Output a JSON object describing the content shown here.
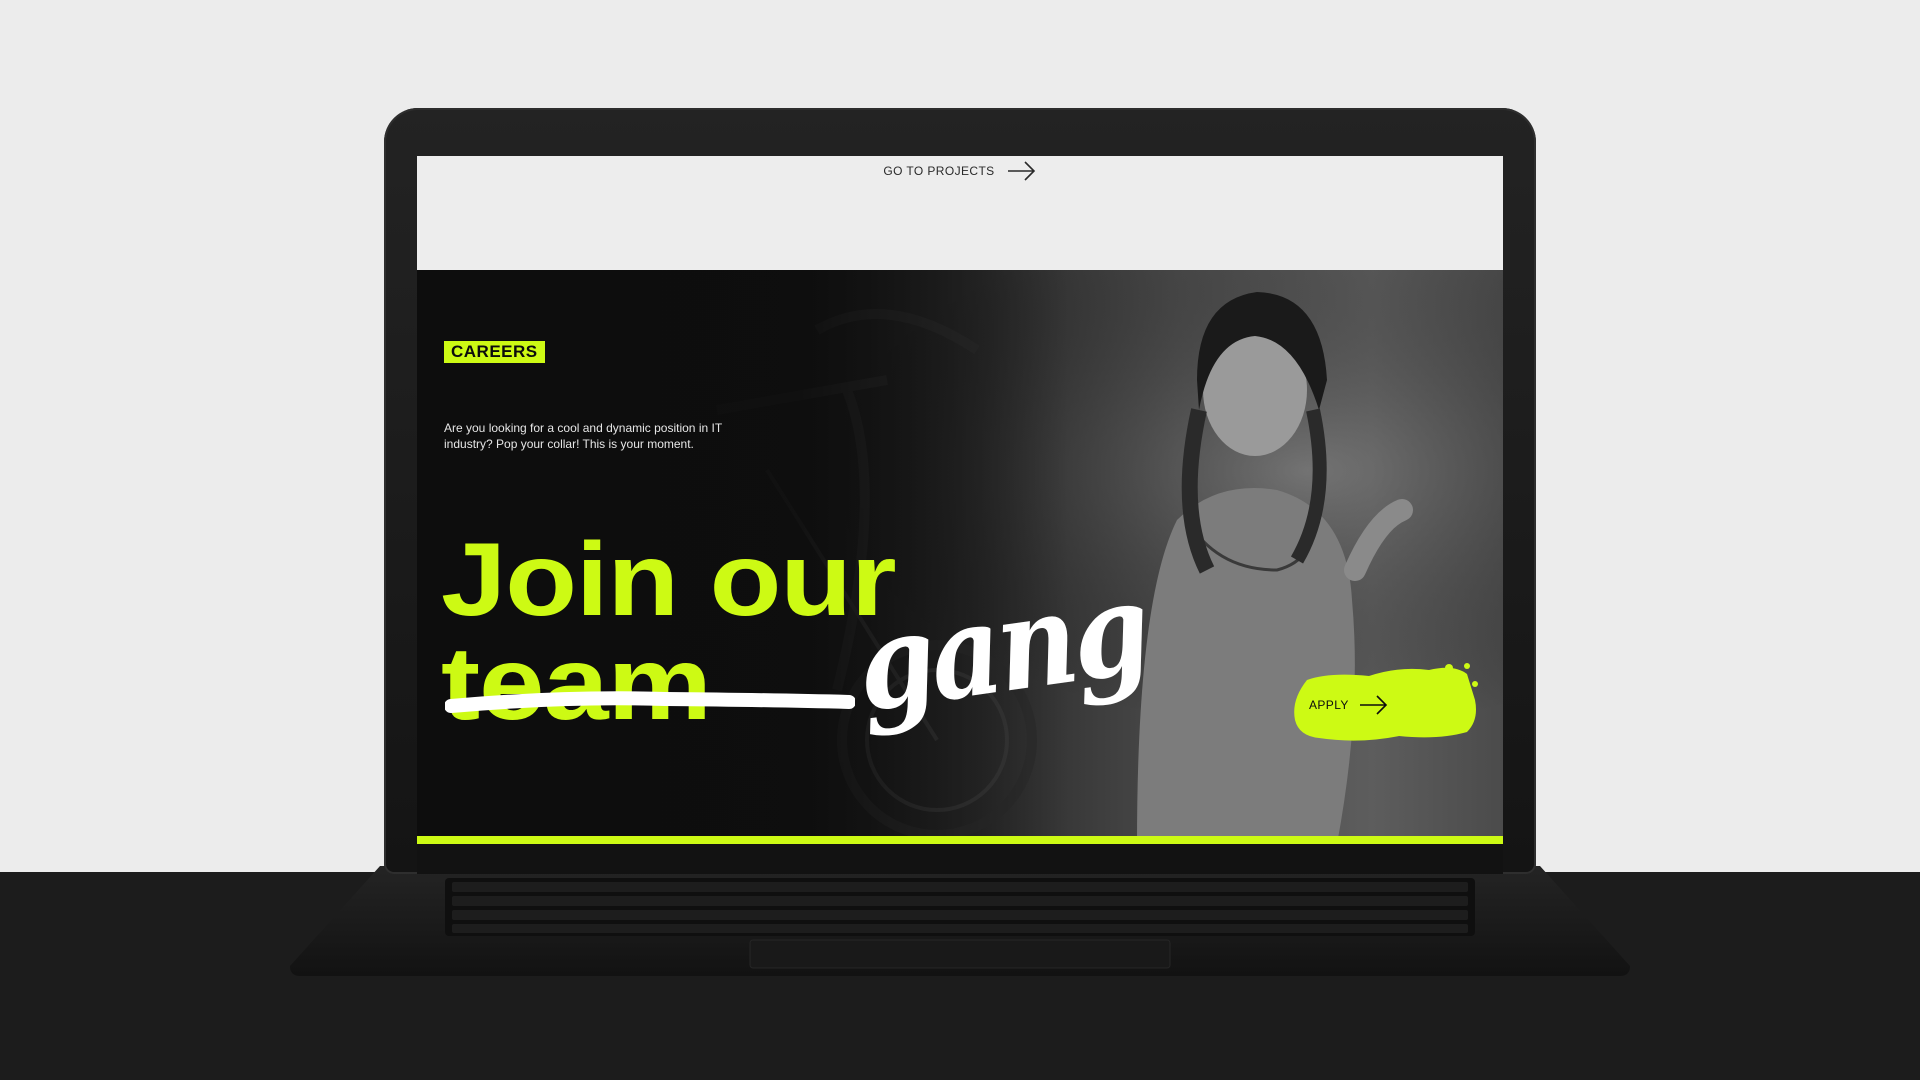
{
  "topbar": {
    "go_to_projects_label": "GO TO PROJECTS"
  },
  "hero": {
    "badge_label": "CAREERS",
    "intro_text": "Are you looking for a cool and dynamic position in IT industry? Pop your collar! This is your moment.",
    "headline_line1": "Join our",
    "headline_struck_word": "team",
    "headline_replacement_word": "gang",
    "apply_label": "APPLY"
  },
  "colors": {
    "accent": "#cdfa14",
    "dark": "#0e0e0e",
    "light": "#ededed"
  },
  "icons": {
    "arrow": "arrow-right-icon"
  }
}
